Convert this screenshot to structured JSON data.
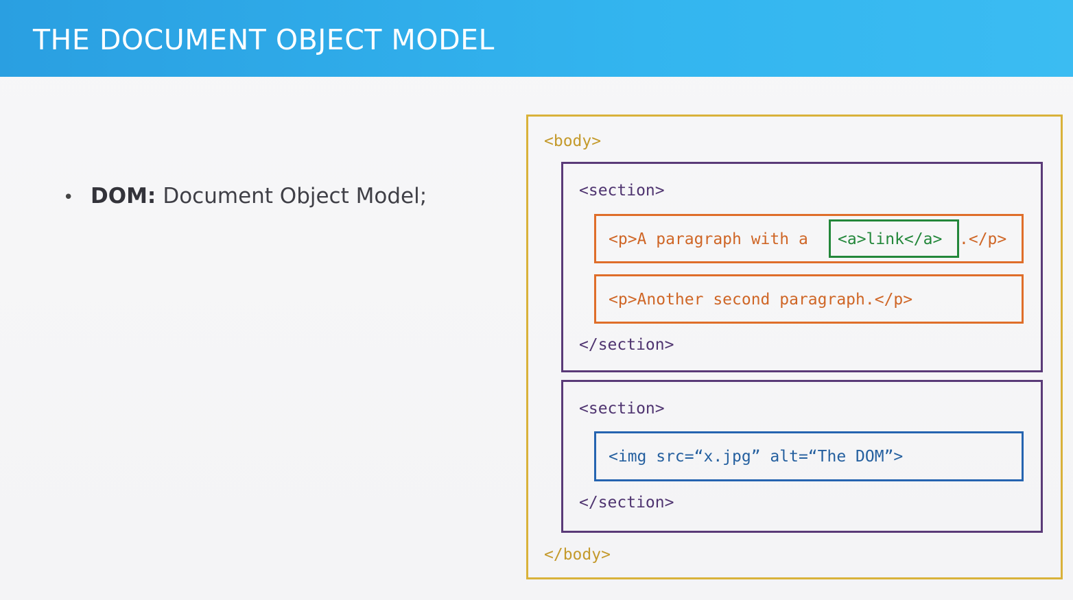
{
  "header": {
    "title": "THE DOCUMENT OBJECT MODEL"
  },
  "bullet": {
    "term": "DOM:",
    "description": "Document Object Model;"
  },
  "diagram": {
    "body_open": "<body>",
    "body_close": "</body>",
    "section1_open": "<section>",
    "section1_close": "</section>",
    "p1_prefix": "<p>A paragraph with a",
    "p1_link": "<a>link</a>",
    "p1_suffix": ".</p>",
    "p2_text": "<p>Another second paragraph.</p>",
    "section2_open": "<section>",
    "section2_close": "</section>",
    "img_text": "<img src=“x.jpg” alt=“The DOM”>"
  },
  "colors": {
    "header": "#33b5ef",
    "body": "#d9b23a",
    "section": "#5a3a78",
    "paragraph": "#df6e2a",
    "link": "#23873a",
    "image": "#2564b0"
  }
}
